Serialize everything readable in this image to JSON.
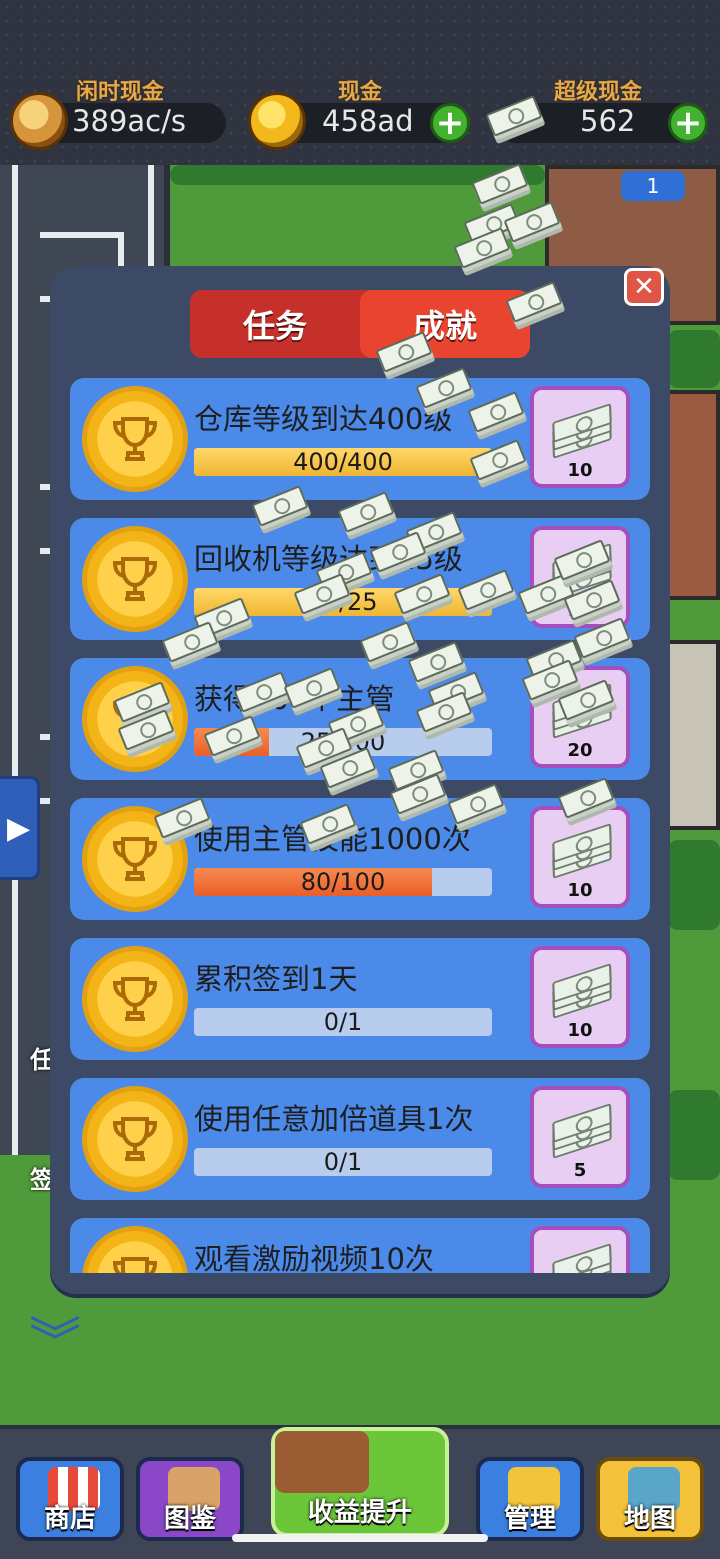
{
  "currency": {
    "idle": {
      "label": "闲时现金",
      "value": "389ac/s"
    },
    "cash": {
      "label": "现金",
      "value": "458ad"
    },
    "super": {
      "label": "超级现金",
      "value": "562"
    }
  },
  "world": {
    "building_badge": "1",
    "side_labels": [
      "任",
      "签"
    ]
  },
  "panel": {
    "close_label": "✕",
    "tabs": [
      {
        "label": "任务",
        "active": false
      },
      {
        "label": "成就",
        "active": true
      }
    ],
    "achievements": [
      {
        "title": "仓库等级到达400级",
        "progress_text": "400/400",
        "progress": 1.0,
        "reward": "10"
      },
      {
        "title": "回收机等级达到25级",
        "progress_text": "25/25",
        "progress": 1.0,
        "reward": "10"
      },
      {
        "title": "获得100个主管",
        "progress_text": "25/100",
        "progress": 0.25,
        "reward": "20"
      },
      {
        "title": "使用主管技能1000次",
        "progress_text": "80/100",
        "progress": 0.8,
        "reward": "10"
      },
      {
        "title": "累积签到1天",
        "progress_text": "0/1",
        "progress": 0.0,
        "reward": "10"
      },
      {
        "title": "使用任意加倍道具1次",
        "progress_text": "0/1",
        "progress": 0.0,
        "reward": "5"
      },
      {
        "title": "观看激励视频10次",
        "progress_text": "",
        "progress": 0.0,
        "reward": ""
      }
    ]
  },
  "nav": {
    "shop": "商店",
    "book": "图鉴",
    "upgrade": "收益提升",
    "manage": "管理",
    "map": "地图"
  },
  "colors": {
    "panel_bg": "#3c4a66",
    "row_bg": "#4b8ae8",
    "tab_inactive": "#c6302a",
    "tab_active": "#e9442f",
    "progress_full": "#f0b531",
    "progress_partial": "#ea5e28",
    "reward_bg": "#e8cef2",
    "plus_green": "#43b32f"
  }
}
